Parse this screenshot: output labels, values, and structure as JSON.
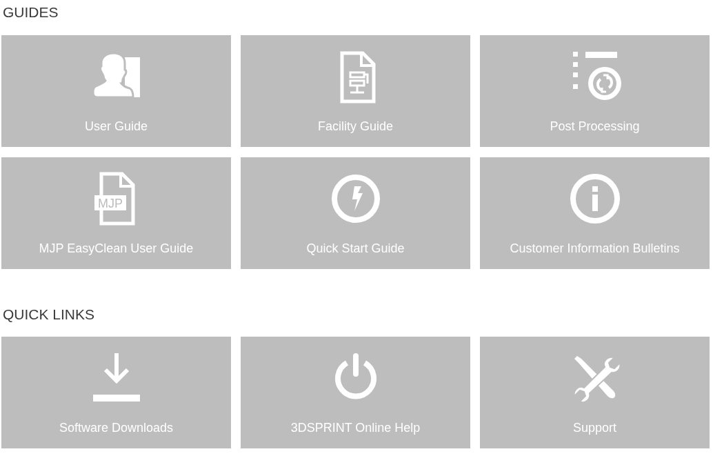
{
  "sections": [
    {
      "heading": "GUIDES",
      "tiles": [
        {
          "kind": "user",
          "label": "User Guide"
        },
        {
          "kind": "document",
          "label": "Facility Guide"
        },
        {
          "kind": "list-cycle",
          "label": "Post Processing"
        },
        {
          "kind": "file-badge",
          "badge": "MJP",
          "label": "MJP EasyClean User Guide"
        },
        {
          "kind": "bolt",
          "label": "Quick Start Guide"
        },
        {
          "kind": "info",
          "label": "Customer Information Bulletins"
        }
      ]
    },
    {
      "heading": "QUICK LINKS",
      "tiles": [
        {
          "kind": "download",
          "label": "Software Downloads"
        },
        {
          "kind": "power",
          "label": "3DSPRINT Online Help"
        },
        {
          "kind": "tools",
          "label": "Support"
        }
      ]
    }
  ]
}
